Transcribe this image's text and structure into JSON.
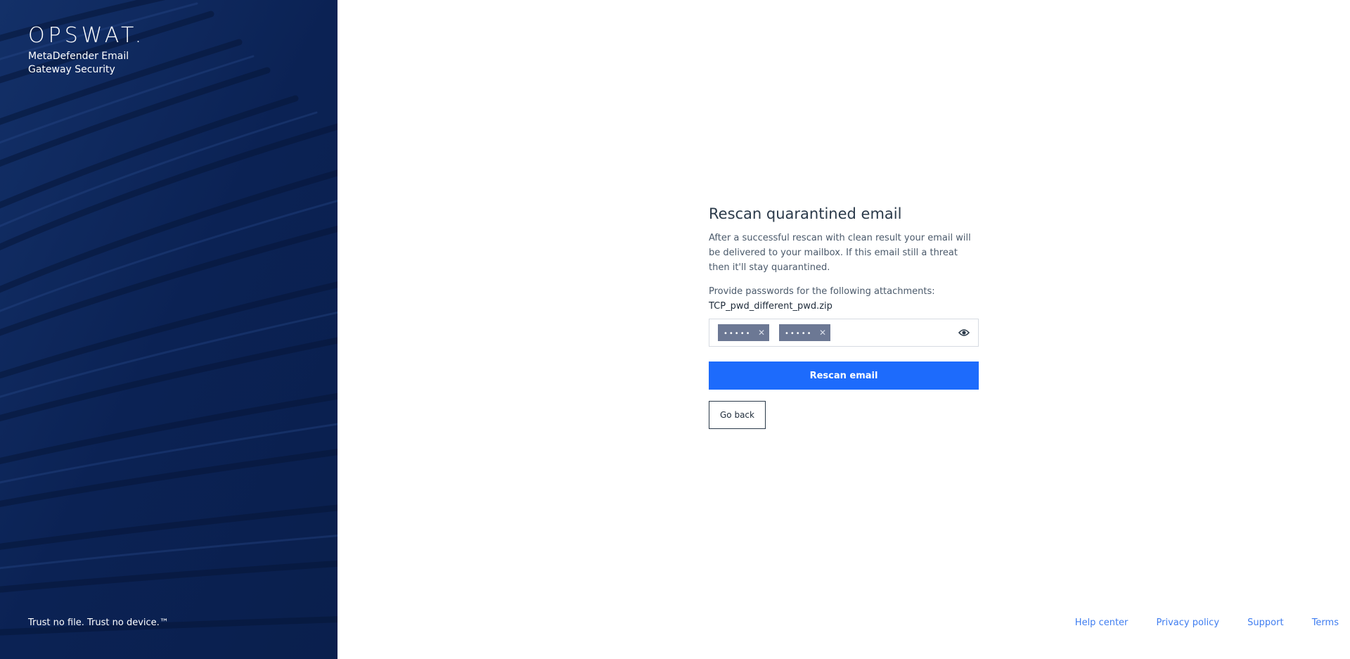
{
  "sidebar": {
    "logo": "OPSWAT.",
    "product_line1": "MetaDefender Email",
    "product_line2": "Gateway Security",
    "tagline": "Trust no file. Trust no device.™",
    "background_color": "#0c2457"
  },
  "panel": {
    "title": "Rescan quarantined email",
    "description": "After a successful rescan with clean result your email will be delivered to your mailbox. If this email still a threat then it'll stay quarantined.",
    "prompt": "Provide passwords for the following attachments:",
    "filename": "TCP_pwd_different_pwd.zip",
    "password_tags": [
      {
        "masked": "•••••",
        "remove": "✕"
      },
      {
        "masked": "•••••",
        "remove": "✕"
      }
    ],
    "visibility_icon": "eye-icon",
    "rescan_button": "Rescan email",
    "back_button": "Go back"
  },
  "footer": {
    "links": [
      "Help center",
      "Privacy policy",
      "Support",
      "Terms"
    ]
  },
  "colors": {
    "primary": "#1d6bfc",
    "link": "#3f7df0",
    "tag": "#6c7894"
  }
}
